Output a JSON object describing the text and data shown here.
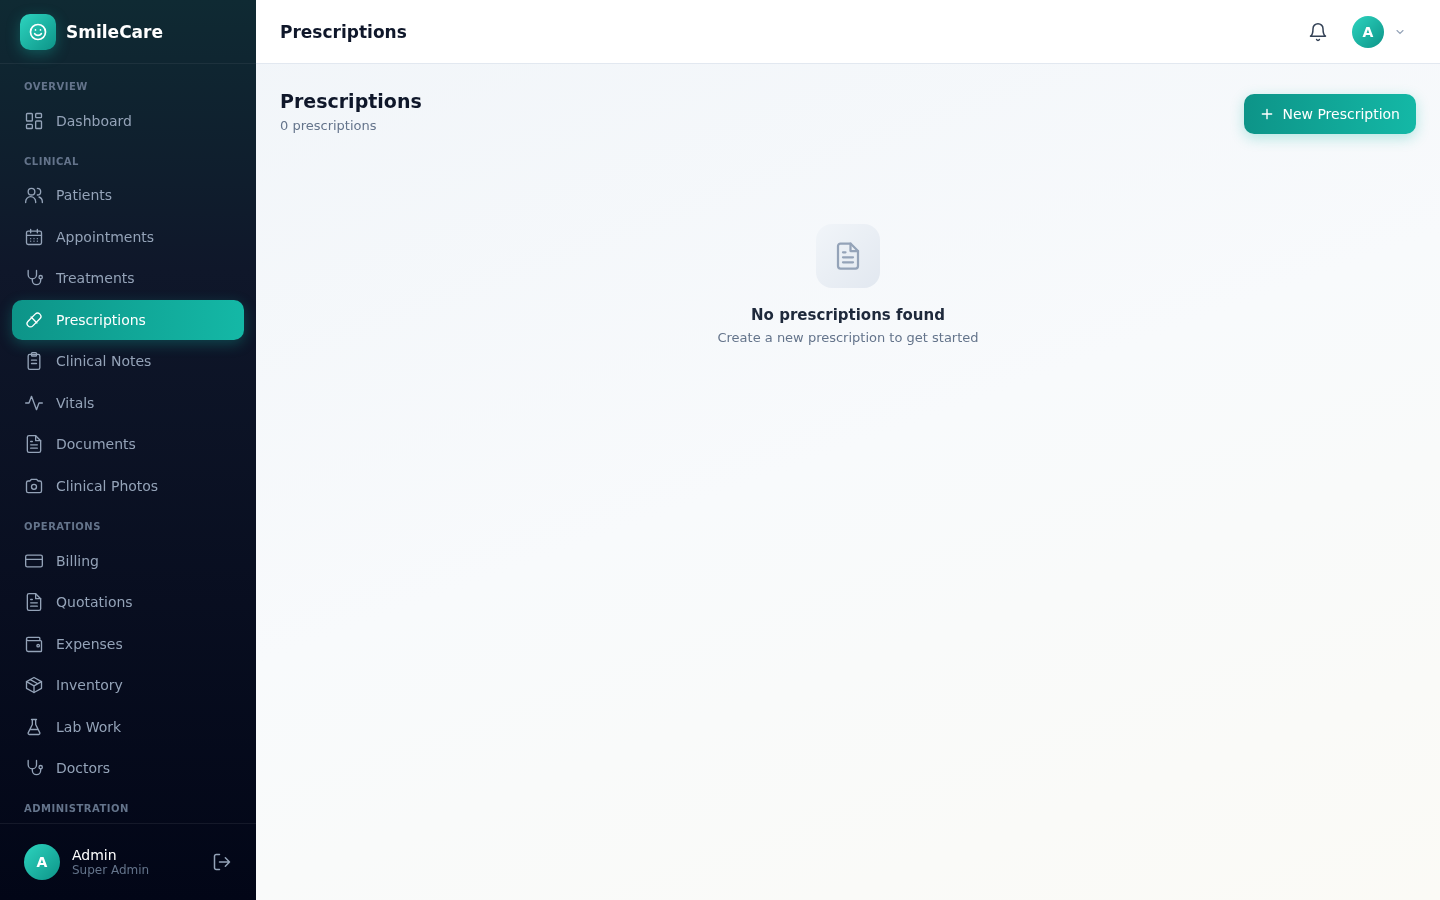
{
  "brand": {
    "name": "SmileCare"
  },
  "sidebar": {
    "sections": [
      {
        "label": "OVERVIEW",
        "items": [
          {
            "label": "Dashboard",
            "selected": false
          }
        ]
      },
      {
        "label": "CLINICAL",
        "items": [
          {
            "label": "Patients",
            "selected": false
          },
          {
            "label": "Appointments",
            "selected": false
          },
          {
            "label": "Treatments",
            "selected": false
          },
          {
            "label": "Prescriptions",
            "selected": true
          },
          {
            "label": "Clinical Notes",
            "selected": false
          },
          {
            "label": "Vitals",
            "selected": false
          },
          {
            "label": "Documents",
            "selected": false
          },
          {
            "label": "Clinical Photos",
            "selected": false
          }
        ]
      },
      {
        "label": "OPERATIONS",
        "items": [
          {
            "label": "Billing",
            "selected": false
          },
          {
            "label": "Quotations",
            "selected": false
          },
          {
            "label": "Expenses",
            "selected": false
          },
          {
            "label": "Inventory",
            "selected": false
          },
          {
            "label": "Lab Work",
            "selected": false
          },
          {
            "label": "Doctors",
            "selected": false
          }
        ]
      },
      {
        "label": "ADMINISTRATION"
      }
    ],
    "user": {
      "initial": "A",
      "name": "Admin",
      "role": "Super Admin"
    }
  },
  "topbar": {
    "title": "Prescriptions",
    "avatar_initial": "A"
  },
  "page": {
    "title": "Prescriptions",
    "count": "0 prescriptions",
    "new_button": "New Prescription",
    "empty_state": {
      "title": "No prescriptions found",
      "message": "Create a new prescription to get started"
    }
  }
}
